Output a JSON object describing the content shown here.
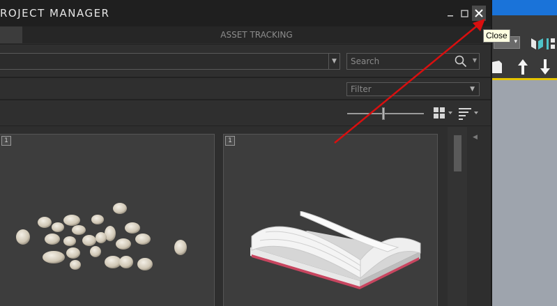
{
  "window": {
    "title": "ROJECT MANAGER",
    "minimize_glyph": "_",
    "maximize_glyph": "☐",
    "close_glyph": "✕"
  },
  "tabs": [
    {
      "label": ""
    },
    {
      "label": "ASSET TRACKING"
    }
  ],
  "toolbar": {
    "path_value": "",
    "search_placeholder": "Search",
    "filter_placeholder": "Filter",
    "thumbnail_size": 0.47
  },
  "assets": [
    {
      "badge": "1",
      "thumbnail": "pebbles"
    },
    {
      "badge": "1",
      "thumbnail": "open-book"
    }
  ],
  "tooltip": {
    "text": "Close"
  },
  "annotation": {
    "color": "#d90f0f",
    "target": "close-button"
  },
  "host_app": {
    "accent_blue": "#1a73d9",
    "accent_yellow": "#e5c400",
    "icons": [
      "up-arrow-icon",
      "down-arrow-icon",
      "mirror-icon"
    ]
  }
}
